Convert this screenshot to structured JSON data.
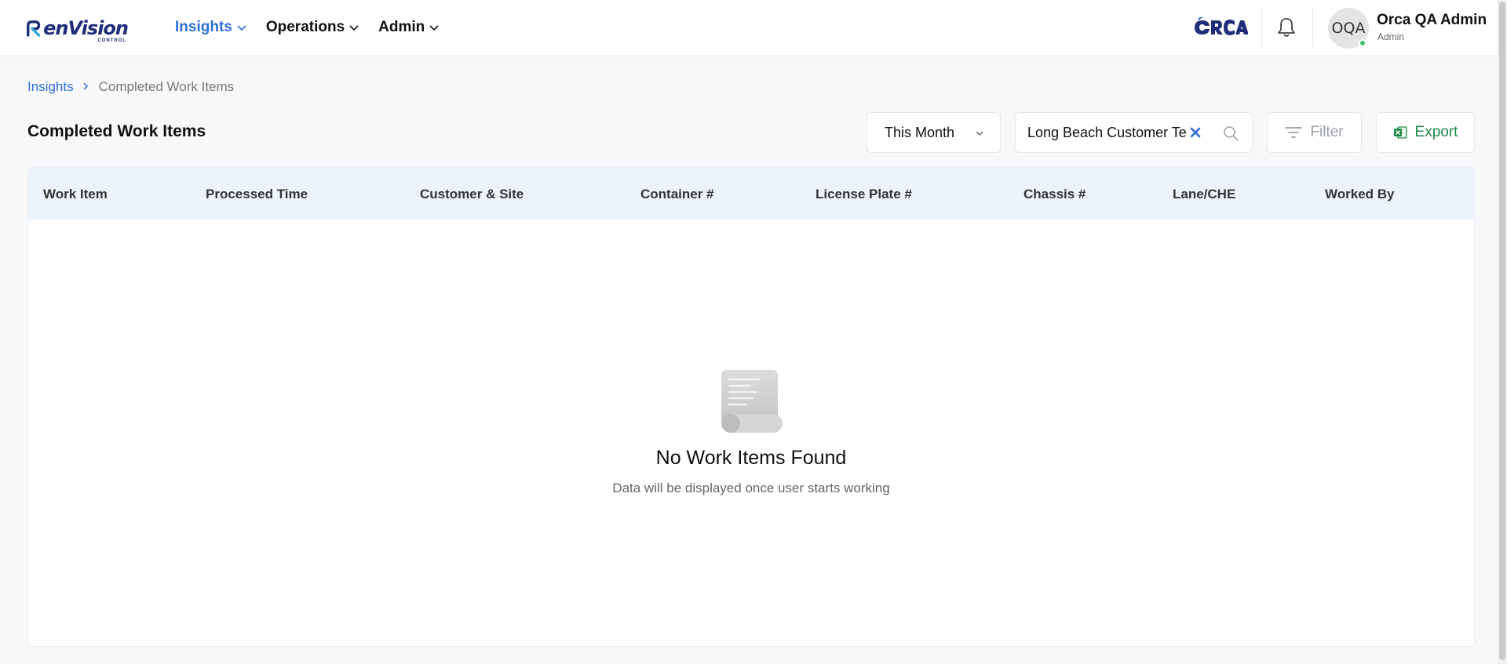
{
  "brand": {
    "logo_word_prefix": "en",
    "logo_word_suffix": "Vision",
    "logo_sub": "CONTROL",
    "partner_logo_icon": "orca-logo-icon",
    "primary_color": "#2f6fdb",
    "navy_color": "#1f2d7a"
  },
  "nav": {
    "items": [
      {
        "label": "Insights",
        "active": true
      },
      {
        "label": "Operations",
        "active": false
      },
      {
        "label": "Admin",
        "active": false
      }
    ]
  },
  "user": {
    "initials": "OQA",
    "name": "Orca QA Admin",
    "role": "Admin",
    "status_color": "#3cc26a"
  },
  "breadcrumb": {
    "root": "Insights",
    "current": "Completed Work Items"
  },
  "page": {
    "title": "Completed Work Items"
  },
  "controls": {
    "period": "This Month",
    "search_value": "Long Beach Customer Te",
    "filter_label": "Filter",
    "export_label": "Export",
    "export_color": "#1e8a45"
  },
  "table": {
    "columns": [
      "Work Item",
      "Processed Time",
      "Customer & Site",
      "Container #",
      "License Plate #",
      "Chassis #",
      "Lane/CHE",
      "Worked By"
    ],
    "header_bg": "#edf3fc",
    "rows": []
  },
  "empty_state": {
    "icon": "empty-document-icon",
    "title": "No Work Items Found",
    "subtitle": "Data will be displayed once user starts working"
  }
}
